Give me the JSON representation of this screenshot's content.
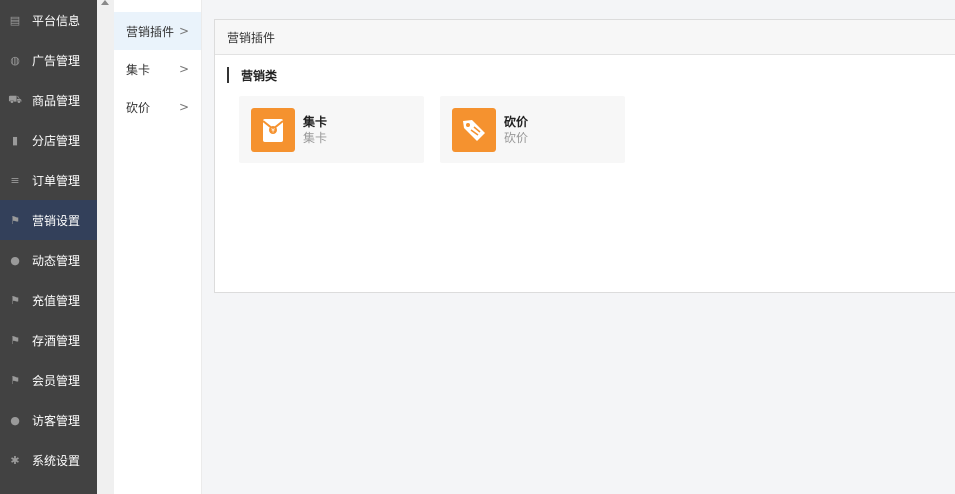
{
  "sidebar": {
    "items": [
      {
        "label": "平台信息",
        "icon": "id-card-icon",
        "glyph": "▤"
      },
      {
        "label": "广告管理",
        "icon": "globe-icon",
        "glyph": "◍"
      },
      {
        "label": "商品管理",
        "icon": "cart-icon",
        "glyph": "⛟"
      },
      {
        "label": "分店管理",
        "icon": "building-icon",
        "glyph": "▮"
      },
      {
        "label": "订单管理",
        "icon": "list-icon",
        "glyph": "≡"
      },
      {
        "label": "营销设置",
        "icon": "gift-icon",
        "glyph": "⚑"
      },
      {
        "label": "动态管理",
        "icon": "user-icon",
        "glyph": "●"
      },
      {
        "label": "充值管理",
        "icon": "gift-icon",
        "glyph": "⚑"
      },
      {
        "label": "存酒管理",
        "icon": "gift-icon",
        "glyph": "⚑"
      },
      {
        "label": "会员管理",
        "icon": "gift-icon",
        "glyph": "⚑"
      },
      {
        "label": "访客管理",
        "icon": "user-icon",
        "glyph": "●"
      },
      {
        "label": "系统设置",
        "icon": "gear-icon",
        "glyph": "✱"
      }
    ],
    "active_index": 5
  },
  "submenu": {
    "items": [
      {
        "label": "营销插件"
      },
      {
        "label": "集卡"
      },
      {
        "label": "砍价"
      }
    ],
    "chevron": ">"
  },
  "panel": {
    "header": "营销插件",
    "section_title": "营销类",
    "cards": [
      {
        "title": "集卡",
        "subtitle": "集卡",
        "icon": "red-envelope-icon"
      },
      {
        "title": "砍价",
        "subtitle": "砍价",
        "icon": "price-tag-icon"
      }
    ]
  },
  "colors": {
    "sidebar_bg": "#424242",
    "sidebar_active": "#33405a",
    "accent_orange": "#f5922f",
    "submenu_active": "#eaf3fb"
  }
}
